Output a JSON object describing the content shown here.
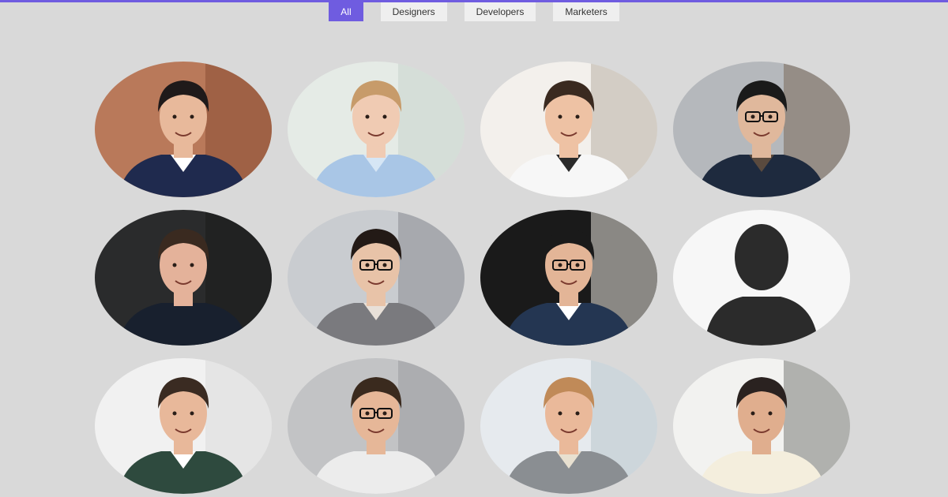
{
  "filters": [
    {
      "label": "All",
      "active": true
    },
    {
      "label": "Designers",
      "active": false
    },
    {
      "label": "Developers",
      "active": false
    },
    {
      "label": "Marketers",
      "active": false
    }
  ],
  "colors": {
    "accent": "#6f5ce0",
    "background": "#d9d9d9",
    "filter_bg": "#efefef"
  },
  "profiles": [
    {
      "bg": "#b9795a",
      "bg2": "#8a4e34",
      "skin": "#e8b99b",
      "hair": "#1f1a1a",
      "shirt": "#1f2a4e",
      "collar": "#ffffff",
      "glasses": false
    },
    {
      "bg": "#e5ebe6",
      "bg2": "#c9d3cc",
      "skin": "#f0cbb3",
      "hair": "#c79b6a",
      "shirt": "#a9c6e6",
      "collar": "#d6e6f5",
      "glasses": false
    },
    {
      "bg": "#f3f0ec",
      "bg2": "#b8b0a6",
      "skin": "#eec2a4",
      "hair": "#3a2a20",
      "shirt": "#f7f7f7",
      "collar": "#2a2a2a",
      "glasses": false
    },
    {
      "bg": "#b5b8bc",
      "bg2": "#7a6a5a",
      "skin": "#e0b89c",
      "hair": "#1a1a1a",
      "shirt": "#1e2a3e",
      "collar": "#5a4a3e",
      "glasses": true
    },
    {
      "bg": "#2a2b2c",
      "bg2": "#1a1b1c",
      "skin": "#e4b29a",
      "hair": "#3a2a20",
      "shirt": "#18202e",
      "collar": "#18202e",
      "glasses": false
    },
    {
      "bg": "#c9ccd0",
      "bg2": "#8a8d92",
      "skin": "#e8c3a8",
      "hair": "#231a16",
      "shirt": "#7a7a7e",
      "collar": "#e8e0d8",
      "glasses": true
    },
    {
      "bg": "#1a1a1a",
      "bg2": "#e8e3dc",
      "skin": "#e3b597",
      "hair": "#1a1a1a",
      "shirt": "#243652",
      "collar": "#ffffff",
      "glasses": true
    },
    {
      "bg": "#f7f7f7",
      "bg2": "#f7f7f7",
      "skin": "#2b2b2b",
      "hair": "#2b2b2b",
      "shirt": "#2b2b2b",
      "collar": "#2b2b2b",
      "glasses": false,
      "silhouette": true
    },
    {
      "bg": "#f1f1f1",
      "bg2": "#dadada",
      "skin": "#e8b89a",
      "hair": "#3a2b22",
      "shirt": "#2e4a3e",
      "collar": "#ffffff",
      "glasses": false
    },
    {
      "bg": "#c2c3c5",
      "bg2": "#9a9b9e",
      "skin": "#e6b798",
      "hair": "#3a2a1e",
      "shirt": "#ececec",
      "collar": "#ececec",
      "glasses": true
    },
    {
      "bg": "#e6eaee",
      "bg2": "#b8c4cc",
      "skin": "#eab99a",
      "hair": "#c08a58",
      "shirt": "#8a8e92",
      "collar": "#e8e0d0",
      "glasses": false
    },
    {
      "bg": "#f2f2f0",
      "bg2": "#7a7c78",
      "skin": "#e0ae8e",
      "hair": "#2a2220",
      "shirt": "#f4eedd",
      "collar": "#f4eedd",
      "glasses": false
    }
  ]
}
